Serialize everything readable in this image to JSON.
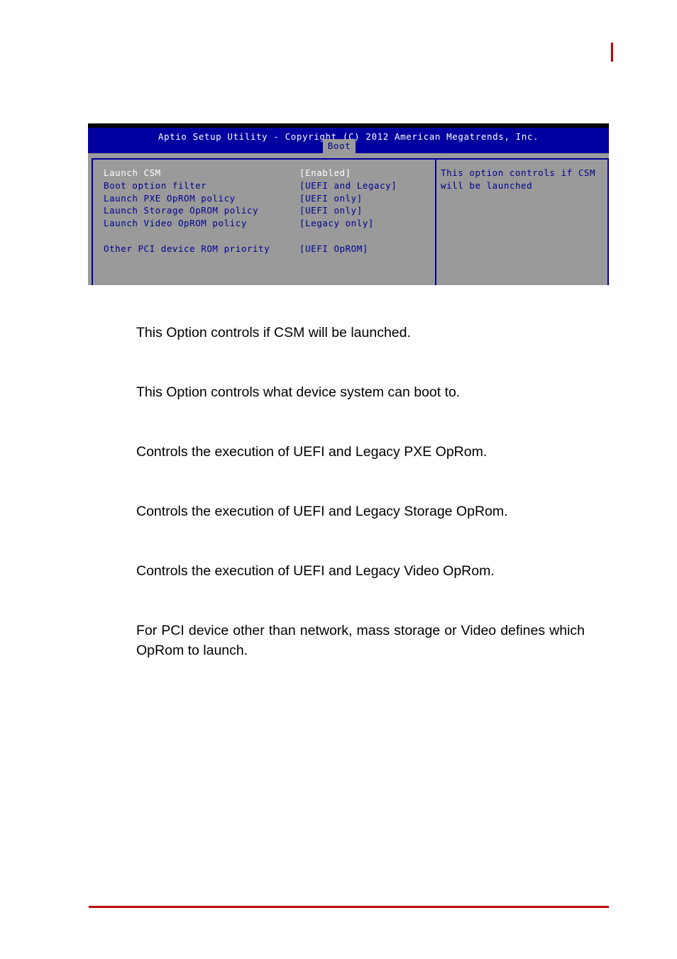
{
  "page": {
    "header_mark_color": "#c00000",
    "footer_rule_color": "#c00000"
  },
  "bios": {
    "title": "Aptio Setup Utility - Copyright (C) 2012 American Megatrends, Inc.",
    "active_tab": "Boot",
    "colors": {
      "titlebar": "#0000a0",
      "panel": "#9a9a9a",
      "text": "#00008f",
      "selected_text": "#ffffff",
      "border": "#0000a0"
    },
    "settings": [
      {
        "label": "Launch CSM",
        "value": "[Enabled]",
        "selected": true
      },
      {
        "label": "Boot option filter",
        "value": "[UEFI and Legacy]",
        "selected": false
      },
      {
        "label": "Launch PXE OpROM policy",
        "value": "[UEFI only]",
        "selected": false
      },
      {
        "label": "Launch Storage OpROM policy",
        "value": "[UEFI only]",
        "selected": false
      },
      {
        "label": "Launch Video OpROM policy",
        "value": "[Legacy only]",
        "selected": false
      },
      {
        "label": "Other PCI device ROM priority",
        "value": "[UEFI OpROM]",
        "selected": false
      }
    ],
    "help_lines": [
      "This option controls if CSM",
      "will be launched"
    ]
  },
  "descriptions": [
    "This Option controls if CSM will be launched.",
    "This Option controls what device system can boot to.",
    "Controls the execution of UEFI and Legacy PXE OpRom.",
    "Controls the execution of UEFI and Legacy Storage OpRom.",
    "Controls the execution of UEFI and Legacy Video OpRom.",
    "For PCI device other than network, mass storage or Video defines which OpRom to launch."
  ]
}
